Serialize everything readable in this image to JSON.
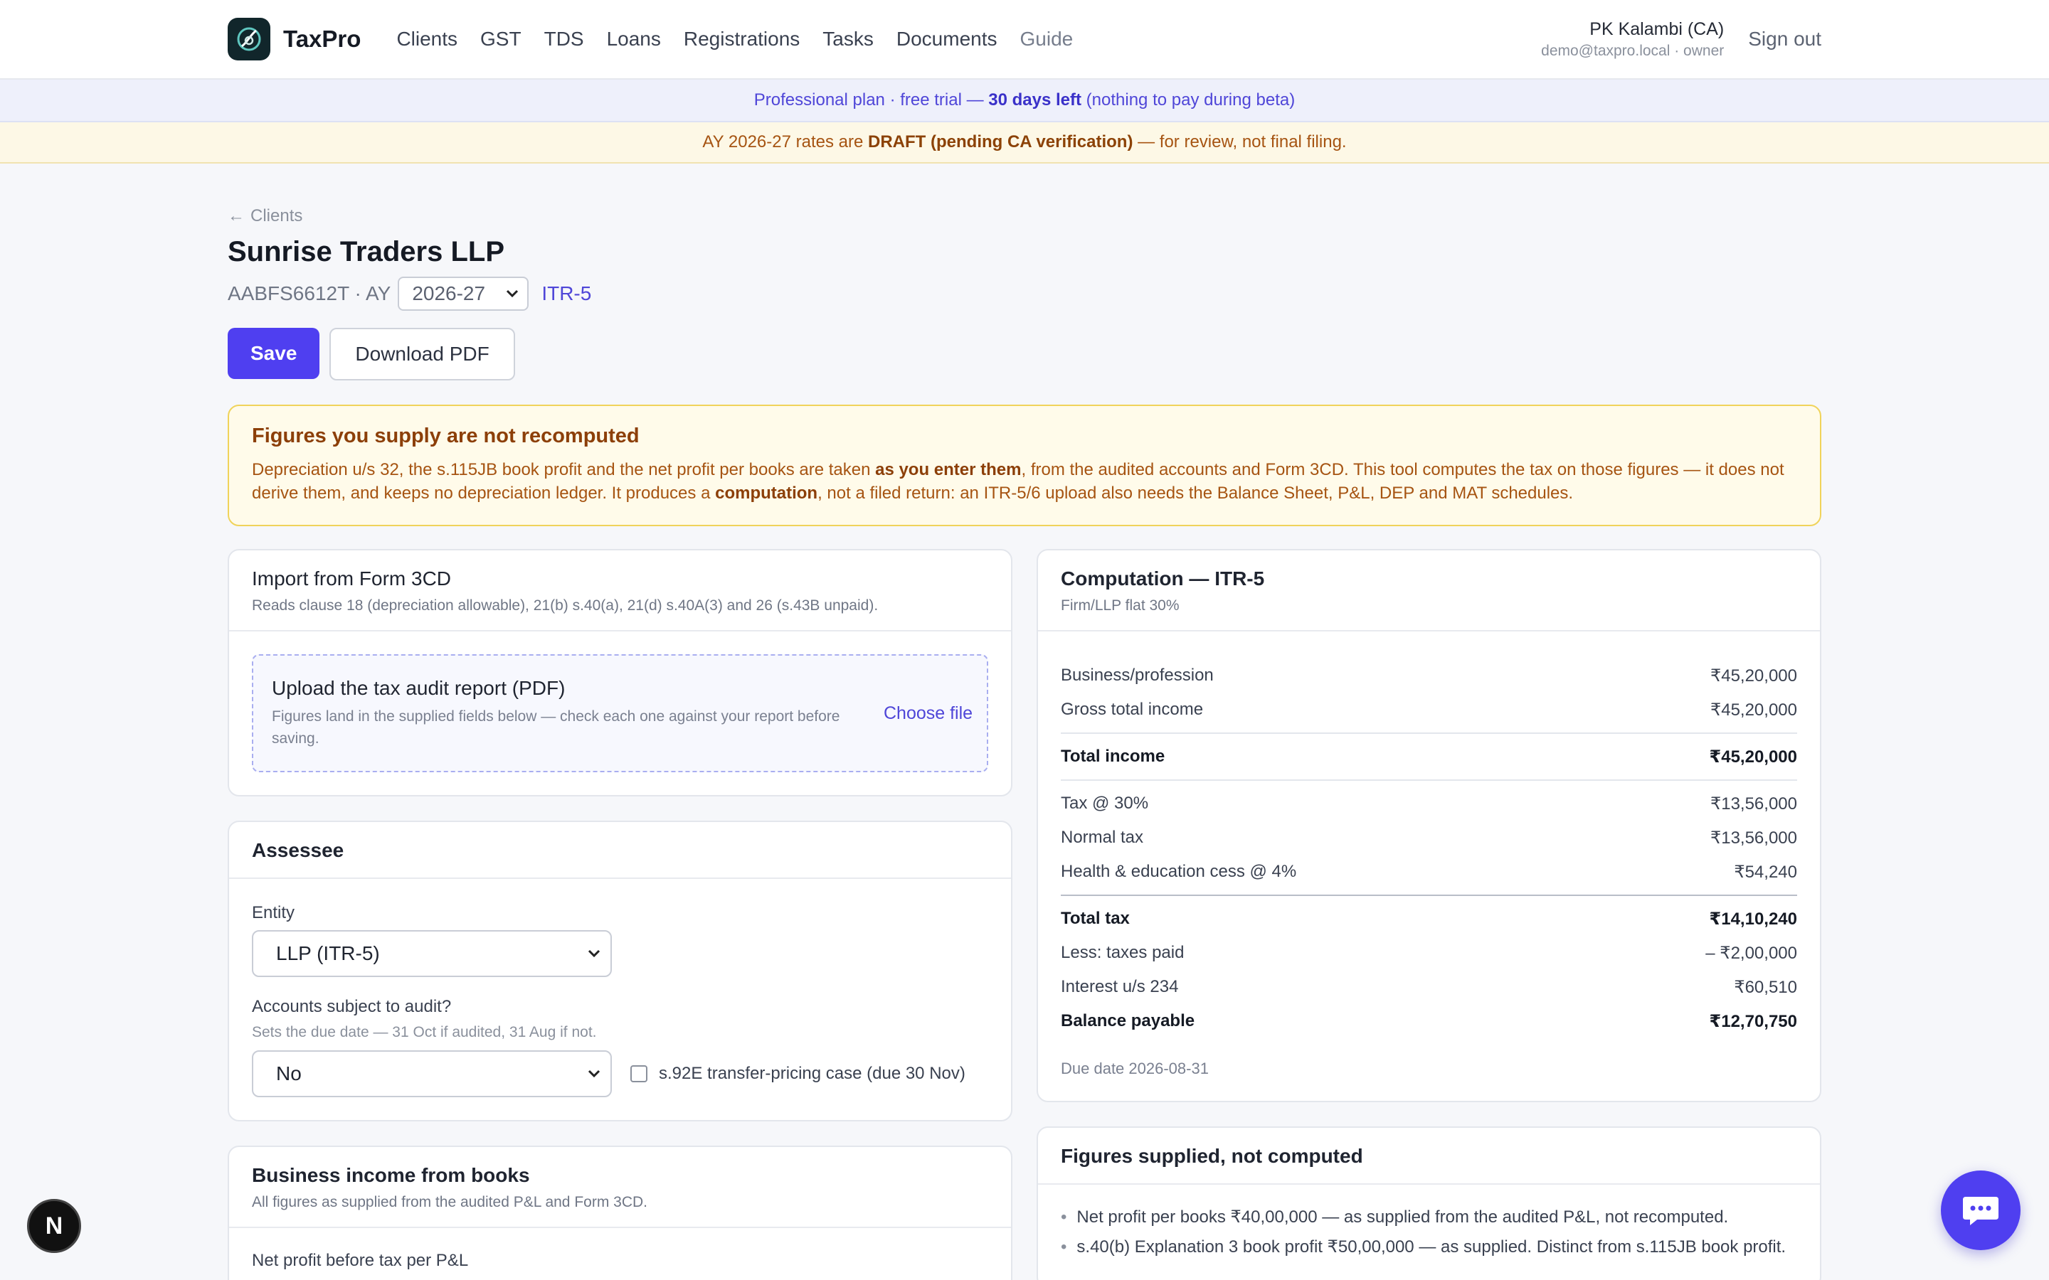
{
  "nav": {
    "brand": "TaxPro",
    "links": [
      "Clients",
      "GST",
      "TDS",
      "Loans",
      "Registrations",
      "Tasks",
      "Documents",
      "Guide"
    ],
    "user_name": "PK Kalambi (CA)",
    "user_sub": "demo@taxpro.local · owner",
    "sign_out": "Sign out"
  },
  "banners": {
    "plan_prefix": "Professional plan · free trial — ",
    "plan_bold": "30 days left",
    "plan_suffix": " (nothing to pay during beta)",
    "draft_prefix": "AY 2026-27 rates are ",
    "draft_bold": "DRAFT (pending CA verification)",
    "draft_suffix": " — for review, not final filing."
  },
  "header": {
    "back": "Clients",
    "title": "Sunrise Traders LLP",
    "pan_prefix": "AABFS6612T · AY",
    "ay_value": "2026-27",
    "itr": "ITR-5",
    "save": "Save",
    "download": "Download PDF"
  },
  "notice": {
    "title": "Figures you supply are not recomputed",
    "p1": "Depreciation u/s 32, the s.115JB book profit and the net profit per books are taken ",
    "b1": "as you enter them",
    "p2": ", from the audited accounts and Form 3CD. This tool computes the tax on those figures — it does not derive them, and keeps no depreciation ledger. It produces a ",
    "b2": "computation",
    "p3": ", not a filed return: an ITR-5/6 upload also needs the Balance Sheet, P&L, DEP and MAT schedules."
  },
  "import": {
    "title": "Import from Form 3CD",
    "sub": "Reads clause 18 (depreciation allowable), 21(b) s.40(a), 21(d) s.40A(3) and 26 (s.43B unpaid).",
    "upload_title": "Upload the tax audit report (PDF)",
    "upload_sub": "Figures land in the supplied fields below — check each one against your report before saving.",
    "choose": "Choose file"
  },
  "assessee": {
    "title": "Assessee",
    "entity_label": "Entity",
    "entity_value": "LLP (ITR-5)",
    "audit_label": "Accounts subject to audit?",
    "audit_hint": "Sets the due date — 31 Oct if audited, 31 Aug if not.",
    "audit_value": "No",
    "tp_label": "s.92E transfer-pricing case (due 30 Nov)"
  },
  "business": {
    "title": "Business income from books",
    "sub": "All figures as supplied from the audited P&L and Form 3CD.",
    "field": "Net profit before tax per P&L"
  },
  "computation": {
    "title": "Computation — ITR-5",
    "sub": "Firm/LLP flat 30%",
    "rows1": [
      {
        "label": "Business/profession",
        "value": "₹45,20,000"
      },
      {
        "label": "Gross total income",
        "value": "₹45,20,000"
      }
    ],
    "total_income": {
      "label": "Total income",
      "value": "₹45,20,000"
    },
    "rows2": [
      {
        "label": "Tax @ 30%",
        "value": "₹13,56,000"
      },
      {
        "label": "Normal tax",
        "value": "₹13,56,000"
      },
      {
        "label": "Health & education cess @ 4%",
        "value": "₹54,240"
      }
    ],
    "total_tax": {
      "label": "Total tax",
      "value": "₹14,10,240"
    },
    "rows3": [
      {
        "label": "Less: taxes paid",
        "value": "– ₹2,00,000"
      },
      {
        "label": "Interest u/s 234",
        "value": "₹60,510"
      }
    ],
    "balance": {
      "label": "Balance payable",
      "value": "₹12,70,750"
    },
    "due": "Due date 2026-08-31"
  },
  "supplied": {
    "title": "Figures supplied, not computed",
    "items": [
      "Net profit per books ₹40,00,000 — as supplied from the audited P&L, not recomputed.",
      "s.40(b) Explanation 3 book profit ₹50,00,000 — as supplied. Distinct from s.115JB book profit."
    ]
  },
  "floaters": {
    "next": "N"
  },
  "colors": {
    "accent": "#4f3ff0",
    "warning_bg": "#fffbea",
    "warning_text": "#a65412"
  }
}
